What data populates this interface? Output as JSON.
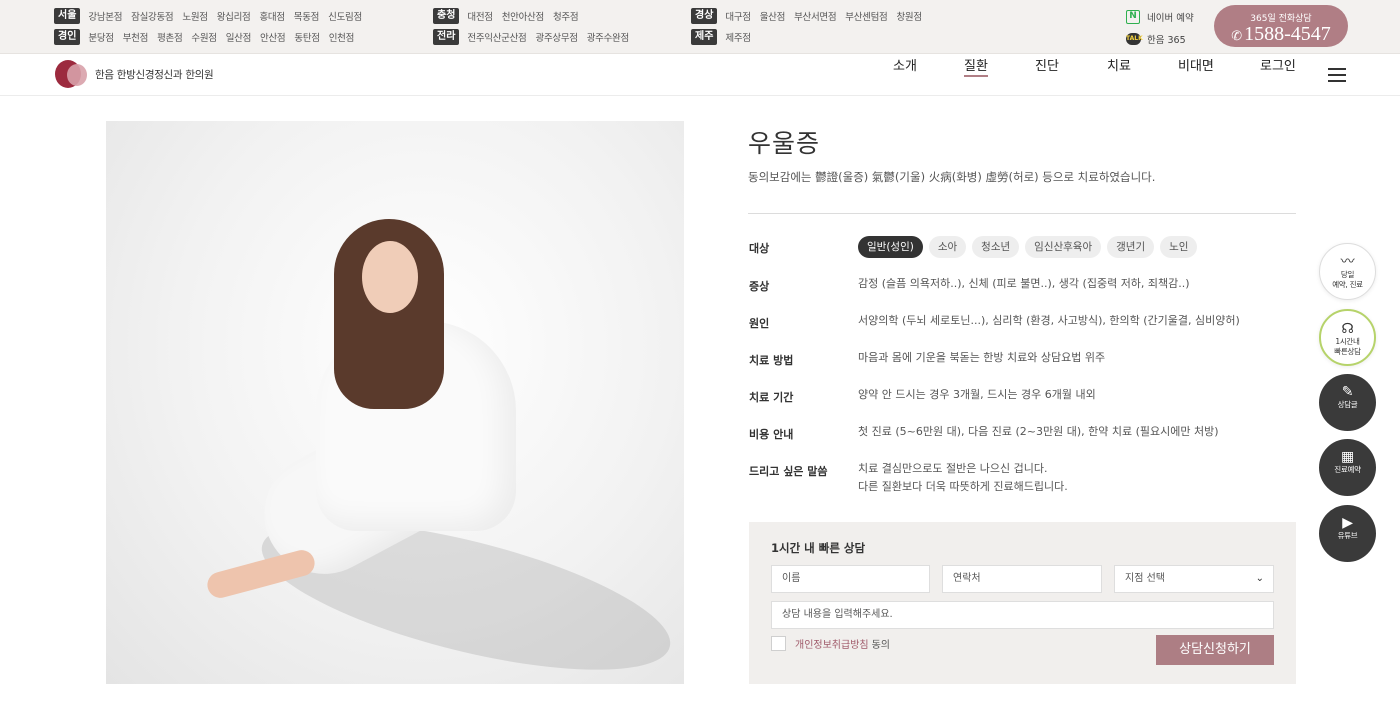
{
  "topbar": {
    "groups": [
      {
        "rows": [
          {
            "tag": "서울",
            "branches": [
              "강남본점",
              "잠실강동점",
              "노원점",
              "왕십리점",
              "홍대점",
              "목동점",
              "신도림점"
            ]
          },
          {
            "tag": "경인",
            "branches": [
              "분당점",
              "부천점",
              "평촌점",
              "수원점",
              "일산점",
              "안산점",
              "동탄점",
              "인천점"
            ]
          }
        ]
      },
      {
        "rows": [
          {
            "tag": "충청",
            "branches": [
              "대전점",
              "천안아산점",
              "청주점"
            ]
          },
          {
            "tag": "전라",
            "branches": [
              "전주익산군산점",
              "광주상무점",
              "광주수완점"
            ]
          }
        ]
      },
      {
        "rows": [
          {
            "tag": "경상",
            "branches": [
              "대구점",
              "울산점",
              "부산서면점",
              "부산센텀점",
              "창원점"
            ]
          },
          {
            "tag": "제주",
            "branches": [
              "제주점"
            ]
          }
        ]
      }
    ],
    "naver_label": "네이버 예약",
    "naver_icon": "N",
    "talk_label": "한음 365",
    "talk_icon": "TALK",
    "call_caption": "365일 전화상담",
    "call_number": "1588-4547",
    "call_color": "#b07e85"
  },
  "nav": {
    "logo_text": "한음 한방신경정신과 한의원",
    "menu": [
      "소개",
      "질환",
      "진단",
      "치료",
      "비대면",
      "로그인"
    ],
    "active_index": 1
  },
  "content": {
    "title": "우울증",
    "subtitle": "동의보감에는 鬱證(울증) 氣鬱(기울) 火病(화병) 虛勞(허로) 등으로 치료하였습니다.",
    "target_label": "대상",
    "targets": [
      "일반(성인)",
      "소아",
      "청소년",
      "임신산후육아",
      "갱년기",
      "노인"
    ],
    "target_active": 0,
    "rows": [
      {
        "label": "증상",
        "lines": [
          "감정 (슬픔 의욕저하..), 신체 (피로 불면..), 생각 (집중력 저하, 죄책감..)"
        ]
      },
      {
        "label": "원인",
        "lines": [
          "서양의학 (두뇌 세로토닌...), 심리학 (환경, 사고방식), 한의학 (간기울결, 심비양허)"
        ]
      },
      {
        "label": "치료 방법",
        "lines": [
          "마음과 몸에 기운을 북돋는 한방 치료와 상담요법 위주"
        ]
      },
      {
        "label": "치료 기간",
        "lines": [
          "양약 안 드시는 경우 3개월, 드시는 경우 6개월 내외"
        ]
      },
      {
        "label": "비용 안내",
        "lines": [
          "첫 진료 (5~6만원 대), 다음 진료 (2~3만원 대), 한약 치료 (필요시에만 처방)"
        ]
      },
      {
        "label": "드리고 싶은 말씀",
        "lines": [
          "치료 결심만으로도 절반은 나으신 겁니다.",
          "다른 질환보다 더욱 따뜻하게 진료해드립니다."
        ]
      }
    ]
  },
  "form": {
    "title": "1시간 내 빠른 상담",
    "name_placeholder": "이름",
    "phone_placeholder": "연락처",
    "branch_select": "지점 선택",
    "message_placeholder": "상담 내용을 입력해주세요.",
    "agree_link": "개인정보취급방침",
    "agree_text": "동의",
    "submit_label": "상담신청하기",
    "accent": "#ad7e84"
  },
  "quick_menu": [
    {
      "icon": "pulse-icon",
      "glyph": "〰",
      "lines": [
        "당일",
        "예약, 진료"
      ],
      "style": "white"
    },
    {
      "icon": "headset-icon",
      "glyph": "☊",
      "lines": [
        "1시간내",
        "빠른상담"
      ],
      "style": "white ring"
    },
    {
      "icon": "pen-icon",
      "glyph": "✎",
      "lines": [
        "상담글"
      ],
      "style": "dark"
    },
    {
      "icon": "calendar-icon",
      "glyph": "▦",
      "lines": [
        "진료예약"
      ],
      "style": "dark"
    },
    {
      "icon": "youtube-icon",
      "glyph": "▶",
      "lines": [
        "유튜브"
      ],
      "style": "dark"
    }
  ]
}
